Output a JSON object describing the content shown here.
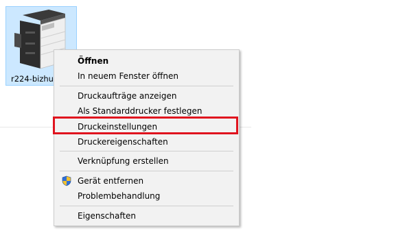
{
  "device": {
    "label": "r224-bizhub",
    "icon": "printer-icon"
  },
  "context_menu": {
    "items": [
      {
        "label": "Öffnen",
        "bold": true
      },
      {
        "label": "In neuem Fenster öffnen"
      },
      {
        "label": "Druckaufträge anzeigen"
      },
      {
        "label": "Als Standarddrucker festlegen"
      },
      {
        "label": "Druckeinstellungen",
        "highlighted": true
      },
      {
        "label": "Druckereigenschaften"
      },
      {
        "label": "Verknüpfung erstellen"
      },
      {
        "label": "Gerät entfernen",
        "icon": "uac-shield-icon"
      },
      {
        "label": "Problembehandlung"
      },
      {
        "label": "Eigenschaften"
      }
    ]
  },
  "colors": {
    "highlight_border": "#e0131e",
    "selection_fill": "#cce8ff"
  }
}
